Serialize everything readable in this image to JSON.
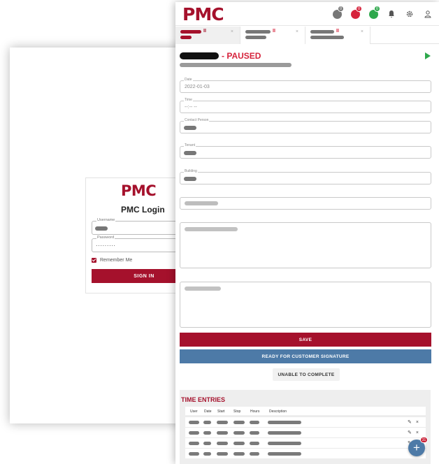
{
  "login": {
    "logo": "PMC",
    "title": "PMC Login",
    "username_label": "Username",
    "password_label": "Password",
    "password_value": "·········",
    "remember_label": "Remember Me",
    "signin_label": "SIGN IN"
  },
  "header": {
    "logo": "PMC",
    "badges": [
      {
        "icon": "pending-icon",
        "count": "0",
        "color": "#777777"
      },
      {
        "icon": "paused-icon",
        "count": "0",
        "color": "#d6233c"
      },
      {
        "icon": "in-progress-icon",
        "count": "0",
        "color": "#2ea84c"
      }
    ],
    "icons": [
      "notification-icon",
      "settings-icon",
      "user-icon"
    ]
  },
  "tabs": [
    {
      "active": true,
      "close": "×",
      "tail": "II",
      "tail_color": "#a5112c"
    },
    {
      "active": false,
      "close": "×",
      "tail": "II",
      "tail_color": "#d6233c"
    },
    {
      "active": false,
      "close": "×",
      "tail": "II",
      "tail_color": "#d6233c"
    }
  ],
  "work_order": {
    "status": "- PAUSED",
    "play_icon": "play-icon"
  },
  "form": {
    "date_label": "Date",
    "date_value": "2022-01-03",
    "time_label": "Time",
    "time_value": "--:-- --",
    "contact_label": "Contact Person",
    "tenant_label": "Tenant",
    "building_label": "Building"
  },
  "buttons": {
    "save": "SAVE",
    "ready": "READY FOR CUSTOMER SIGNATURE",
    "unable": "UNABLE TO COMPLETE"
  },
  "time_entries": {
    "title": "TIME ENTRIES",
    "columns": [
      "User",
      "Date",
      "Start",
      "Stop",
      "Hours",
      "Description"
    ],
    "row_count_visible": 4,
    "edit_icon": "✎",
    "delete_icon": "×"
  },
  "fab": {
    "label": "+",
    "badge": "31"
  },
  "colors": {
    "brand": "#a5112c",
    "paused": "#d6233c",
    "play": "#2ea84c",
    "secondary": "#4d7aa7"
  }
}
